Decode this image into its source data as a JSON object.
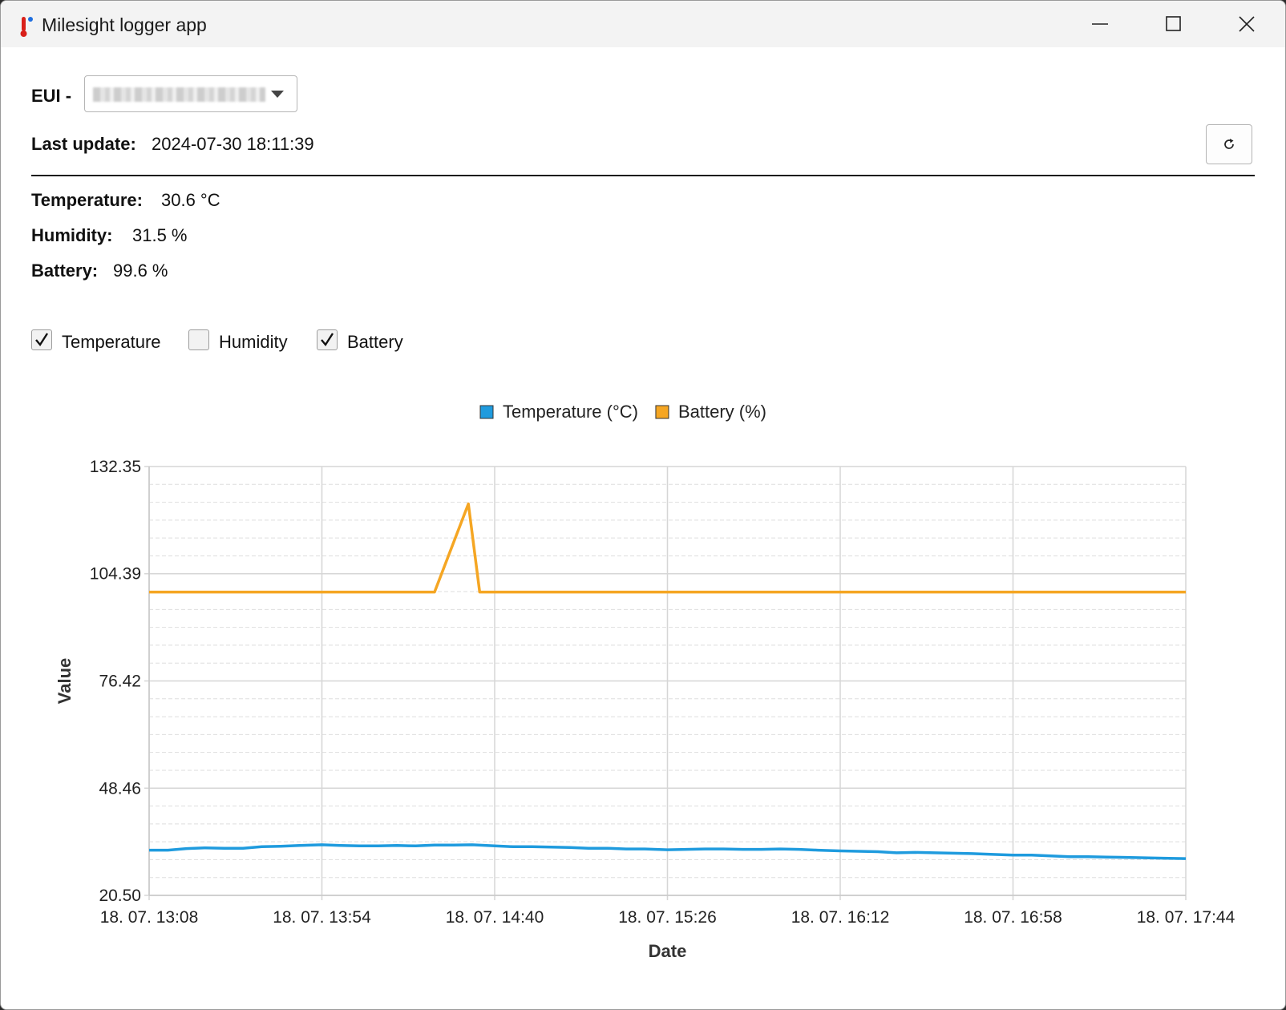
{
  "window": {
    "title": "Milesight logger app",
    "controls": {
      "minimize": "minimize",
      "maximize": "maximize",
      "close": "close"
    }
  },
  "header": {
    "eui_label": "EUI -",
    "eui_value": "",
    "last_update_label": "Last update:",
    "last_update_value": "2024-07-30 18:11:39"
  },
  "stats": [
    {
      "label": "Temperature:",
      "value": "30.6 °C"
    },
    {
      "label": "Humidity:",
      "value": "31.5 %"
    },
    {
      "label": "Battery:",
      "value": "99.6 %"
    }
  ],
  "toggles": [
    {
      "label": "Temperature",
      "checked": true
    },
    {
      "label": "Humidity",
      "checked": false
    },
    {
      "label": "Battery",
      "checked": true
    }
  ],
  "chart_data": {
    "type": "line",
    "title": "",
    "xlabel": "Date",
    "ylabel": "Value",
    "ylim": [
      20.5,
      132.35
    ],
    "yticks": [
      "132.35",
      "104.39",
      "76.42",
      "48.46",
      "20.50"
    ],
    "xlim": [
      "13:08",
      "17:44"
    ],
    "xticks": [
      "18. 07. 13:08",
      "18. 07. 13:54",
      "18. 07. 14:40",
      "18. 07. 15:26",
      "18. 07. 16:12",
      "18. 07. 16:58",
      "18. 07. 17:44"
    ],
    "grid": true,
    "legend_position": "top-center",
    "series": [
      {
        "name": "Temperature (°C)",
        "color": "#1f9bde",
        "x": [
          "13:08",
          "13:13",
          "13:18",
          "13:23",
          "13:28",
          "13:33",
          "13:38",
          "13:43",
          "13:48",
          "13:54",
          "13:59",
          "14:04",
          "14:09",
          "14:14",
          "14:19",
          "14:24",
          "14:29",
          "14:34",
          "14:40",
          "14:45",
          "14:50",
          "14:55",
          "15:00",
          "15:05",
          "15:10",
          "15:15",
          "15:20",
          "15:26",
          "15:31",
          "15:36",
          "15:41",
          "15:46",
          "15:51",
          "15:56",
          "16:01",
          "16:06",
          "16:12",
          "16:17",
          "16:22",
          "16:27",
          "16:32",
          "16:37",
          "16:42",
          "16:47",
          "16:52",
          "16:58",
          "17:03",
          "17:08",
          "17:13",
          "17:18",
          "17:23",
          "17:28",
          "17:33",
          "17:38",
          "17:44"
        ],
        "values": [
          32.3,
          32.3,
          32.7,
          32.9,
          32.8,
          32.8,
          33.2,
          33.3,
          33.5,
          33.7,
          33.5,
          33.4,
          33.4,
          33.5,
          33.4,
          33.6,
          33.6,
          33.7,
          33.4,
          33.2,
          33.2,
          33.1,
          33.0,
          32.8,
          32.8,
          32.6,
          32.6,
          32.4,
          32.5,
          32.6,
          32.6,
          32.5,
          32.5,
          32.6,
          32.5,
          32.3,
          32.1,
          32.0,
          31.9,
          31.6,
          31.7,
          31.6,
          31.5,
          31.4,
          31.2,
          31.0,
          31.0,
          30.8,
          30.6,
          30.6,
          30.5,
          30.4,
          30.3,
          30.2,
          30.1
        ]
      },
      {
        "name": "Battery (%)",
        "color": "#f5a623",
        "x": [
          "13:08",
          "14:24",
          "14:33",
          "14:36",
          "17:44"
        ],
        "values": [
          99.6,
          99.6,
          122.6,
          99.6,
          99.6
        ]
      }
    ]
  }
}
